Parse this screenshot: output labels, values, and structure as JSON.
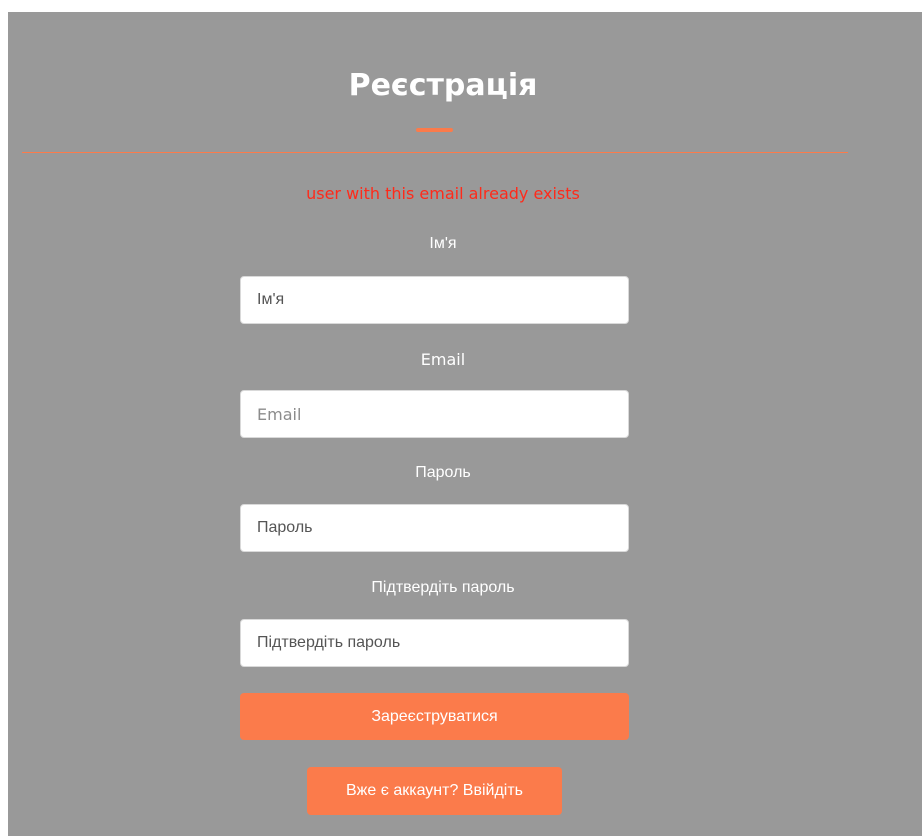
{
  "form": {
    "title": "Реєстрація",
    "error_message": "user with this email already exists",
    "fields": {
      "name": {
        "label": "Ім'я",
        "placeholder": "Ім'я"
      },
      "email": {
        "label": "Email",
        "placeholder": "Email"
      },
      "password": {
        "label": "Пароль",
        "placeholder": "Пароль"
      },
      "confirm_password": {
        "label": "Підтвердіть пароль",
        "placeholder": "Підтвердіть пароль"
      }
    },
    "register_button": "Зареєструватися",
    "login_link_button": "Вже є аккаунт? Ввійдіть"
  },
  "colors": {
    "panel_background": "#999999",
    "accent": "#fb7b4b",
    "error": "#ff2a1a"
  }
}
